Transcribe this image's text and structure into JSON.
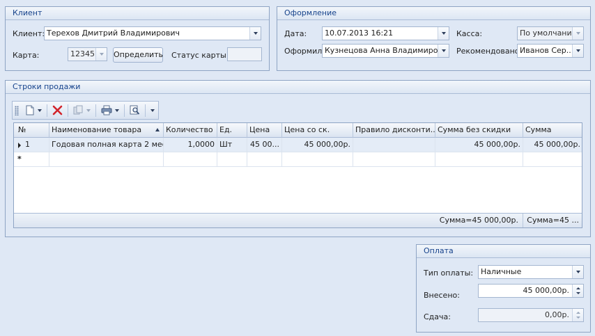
{
  "client": {
    "title": "Клиент",
    "client_label": "Клиент:",
    "client_value": "Терехов Дмитрий Владимирович",
    "card_label": "Карта:",
    "card_value": "12345",
    "determine_button": "Определить",
    "card_status_label": "Статус карты:",
    "card_status_value": ""
  },
  "registration": {
    "title": "Оформление",
    "date_label": "Дата:",
    "date_value": "10.07.2013 16:21",
    "cashbox_label": "Касса:",
    "cashbox_value": "По умолчанию",
    "issued_by_label": "Оформил:",
    "issued_by_value": "Кузнецова Анна Владимировна",
    "recommended_label": "Рекомендовано:",
    "recommended_value": "Иванов Сер..."
  },
  "sales": {
    "title": "Строки продажи",
    "toolbar": [
      "new-doc-icon",
      "delete-icon",
      "copy-icon",
      "print-icon",
      "preview-icon"
    ],
    "columns": [
      "№",
      "Наименование товара",
      "Количество",
      "Ед.",
      "Цена",
      "Цена со ск.",
      "Правило дисконти...",
      "Сумма без скидки",
      "Сумма"
    ],
    "rows": [
      {
        "no": "1",
        "name": "Годовая полная карта 2 мес...",
        "qty": "1,0000",
        "unit": "Шт",
        "price": "45 00...",
        "price_disc": "45 000,00р.",
        "rule": "",
        "sum_no_disc": "45 000,00р.",
        "sum": "45 000,00р."
      }
    ],
    "new_row_marker": "*",
    "footer": {
      "sum_no_disc": "Сумма=45 000,00р.",
      "sum": "Сумма=45 ..."
    }
  },
  "payment": {
    "title": "Оплата",
    "type_label": "Тип оплаты:",
    "type_value": "Наличные",
    "paid_label": "Внесено:",
    "paid_value": "45 000,00р.",
    "change_label": "Сдача:",
    "change_value": "0,00р."
  },
  "colors": {
    "background": "#dfe8f5",
    "header_text": "#15428b",
    "selected_row": "#e4ecf7",
    "delete_red": "#d2232a"
  }
}
